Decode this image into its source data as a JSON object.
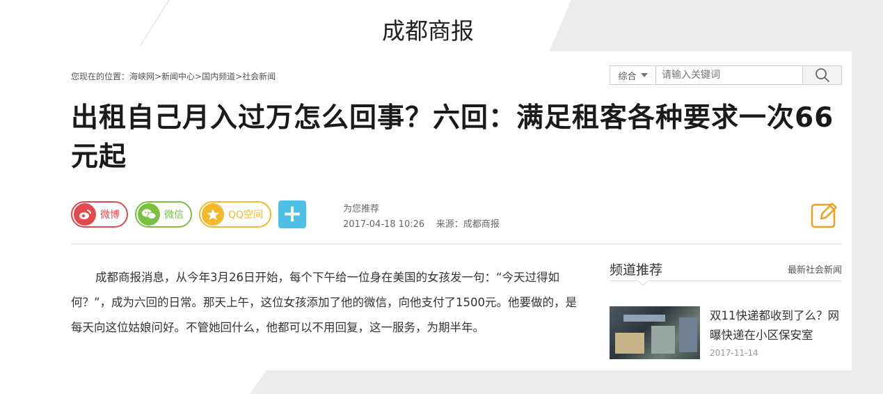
{
  "header": {
    "title": "成都商报"
  },
  "breadcrumb": "您现在的位置：海峡网>新闻中心>国内频道>社会新闻",
  "search": {
    "scope": "综合",
    "placeholder": "请输入关键词"
  },
  "article": {
    "headline": "出租自己月入过万怎么回事？六回：满足租客各种要求一次66元起",
    "recommend_label": "为您推荐",
    "datetime": "2017-04-18 10:26",
    "source": "来源：成都商报",
    "body": "成都商报消息，从今年3月26日开始，每个下午给一位身在美国的女孩发一句：“今天过得如何？”，成为六回的日常。那天上午，这位女孩添加了他的微信，向他支付了1500元。他要做的，是每天向这位姑娘问好。不管她回什么，他都可以不用回复，这一服务，为期半年。"
  },
  "share": {
    "weibo": "微博",
    "wechat": "微信",
    "qzone": "QQ空间",
    "more": "+"
  },
  "sidebar": {
    "title": "频道推荐",
    "more": "最新社会新闻",
    "items": [
      {
        "title": "双11快递都收到了么？网曝快递在小区保安室",
        "date": "2017-11-14"
      }
    ]
  },
  "colors": {
    "weibo": "#e4494d",
    "wechat": "#7ac142",
    "qzone": "#f3b82c",
    "plus": "#4fc1e9",
    "edit": "#f0a020"
  }
}
